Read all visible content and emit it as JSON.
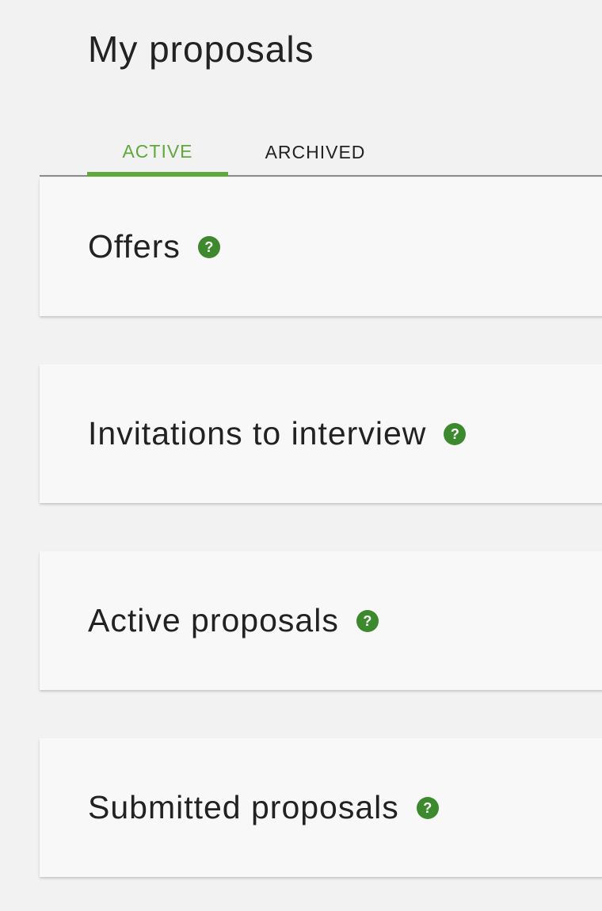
{
  "page": {
    "title": "My proposals"
  },
  "tabs": [
    {
      "label": "ACTIVE",
      "selected": true
    },
    {
      "label": "ARCHIVED",
      "selected": false
    }
  ],
  "sections": [
    {
      "title": "Offers",
      "help_icon": "question-circle-icon"
    },
    {
      "title": "Invitations to interview",
      "help_icon": "question-circle-icon"
    },
    {
      "title": "Active proposals",
      "help_icon": "question-circle-icon"
    },
    {
      "title": "Submitted proposals",
      "help_icon": "question-circle-icon"
    }
  ],
  "help_glyph": "?",
  "colors": {
    "accent": "#5fa83c",
    "help_icon_bg": "#3d8a2e",
    "background": "#f2f2f2",
    "card_bg": "#f8f8f8",
    "text": "#222222"
  }
}
